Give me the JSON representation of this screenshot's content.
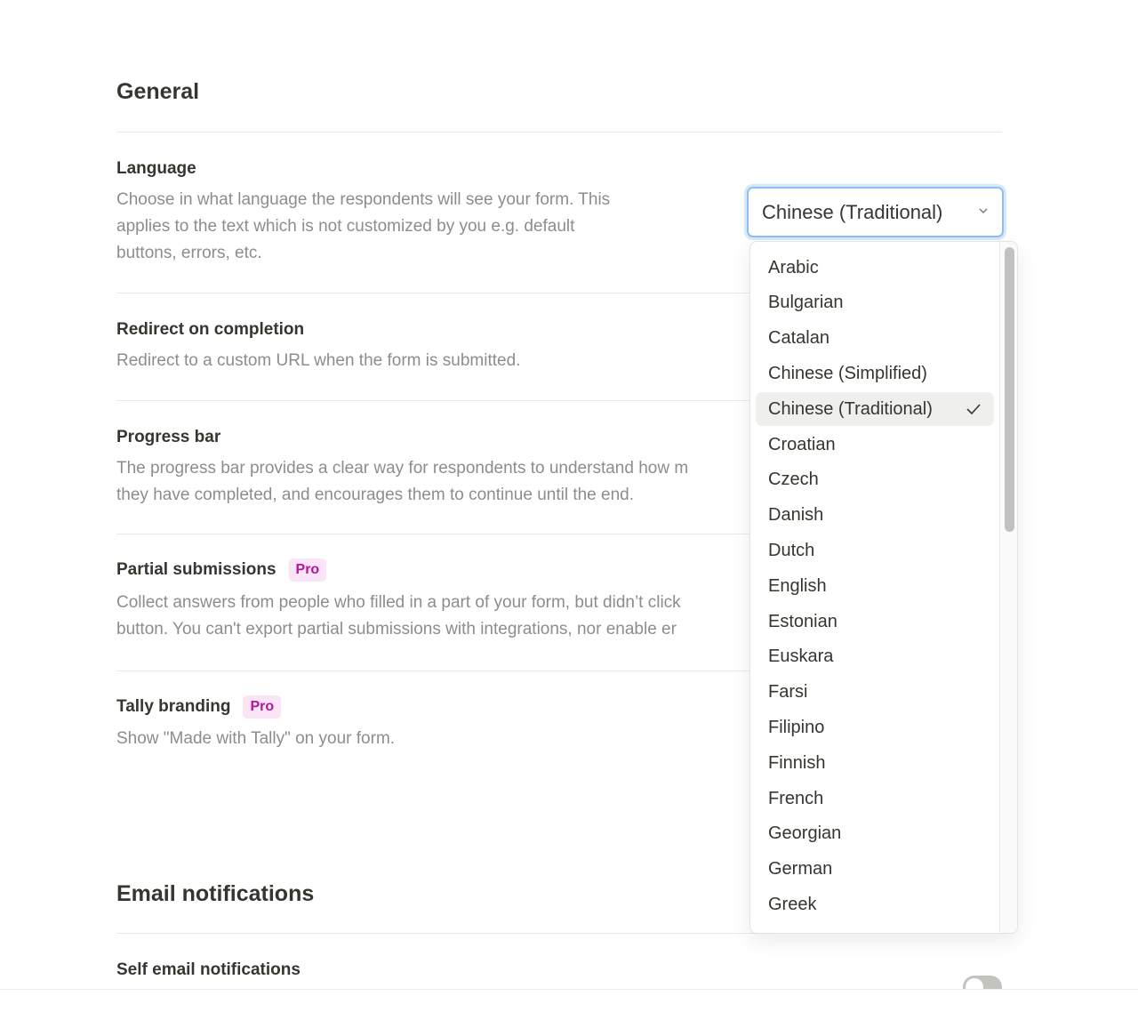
{
  "general": {
    "heading": "General",
    "settings": [
      {
        "title": "Language",
        "desc": [
          "Choose in what language the respondents will see your form. This",
          "applies to the text which is not customized by you e.g. default",
          "buttons, errors, etc."
        ]
      },
      {
        "title": "Redirect on completion",
        "desc": [
          "Redirect to a custom URL when the form is submitted."
        ]
      },
      {
        "title": "Progress bar",
        "desc": [
          "The progress bar provides a clear way for respondents to understand how m",
          "they have completed, and encourages them to continue until the end."
        ]
      },
      {
        "title": "Partial submissions",
        "badge": "Pro",
        "desc": [
          "Collect answers from people who filled in a part of your form, but didn’t click",
          "button. You can't export partial submissions with integrations, nor enable er"
        ]
      },
      {
        "title": "Tally branding",
        "badge": "Pro",
        "desc": [
          "Show \"Made with Tally\" on your form."
        ]
      }
    ]
  },
  "language_select": {
    "value": "Chinese (Traditional)",
    "options": [
      "Arabic",
      "Bulgarian",
      "Catalan",
      "Chinese (Simplified)",
      "Chinese (Traditional)",
      "Croatian",
      "Czech",
      "Danish",
      "Dutch",
      "English",
      "Estonian",
      "Euskara",
      "Farsi",
      "Filipino",
      "Finnish",
      "French",
      "Georgian",
      "German",
      "Greek"
    ],
    "selected_index": 4
  },
  "email": {
    "heading": "Email notifications",
    "self_title": "Self email notifications",
    "self_enabled": false
  },
  "colors": {
    "accent_ring": "#8fbff0",
    "pro_text": "#b0179e",
    "pro_bg": "#fce4f7"
  }
}
